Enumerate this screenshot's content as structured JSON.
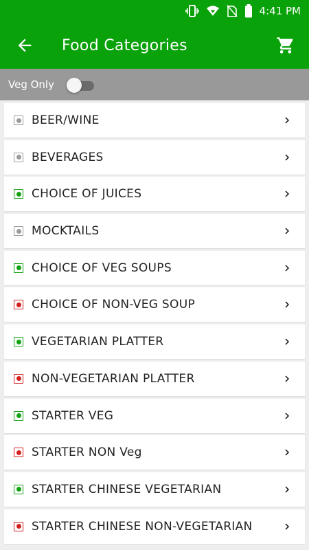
{
  "status_bar": {
    "time": "4:41 PM"
  },
  "app_bar": {
    "title": "Food Categories"
  },
  "filter": {
    "label": "Veg Only",
    "enabled": false
  },
  "colors": {
    "primary": "#0aa20a",
    "veg": "#13a313",
    "non_veg": "#d32020",
    "neutral": "#9a9a9a"
  },
  "categories": [
    {
      "label": "BEER/WINE",
      "type": "neutral"
    },
    {
      "label": "BEVERAGES",
      "type": "neutral"
    },
    {
      "label": "CHOICE OF JUICES",
      "type": "veg"
    },
    {
      "label": "MOCKTAILS",
      "type": "neutral"
    },
    {
      "label": "CHOICE OF VEG SOUPS",
      "type": "veg"
    },
    {
      "label": "CHOICE OF NON-VEG SOUP",
      "type": "non_veg"
    },
    {
      "label": "VEGETARIAN PLATTER",
      "type": "veg"
    },
    {
      "label": "NON-VEGETARIAN PLATTER",
      "type": "non_veg"
    },
    {
      "label": "STARTER VEG",
      "type": "veg"
    },
    {
      "label": "STARTER NON Veg",
      "type": "non_veg"
    },
    {
      "label": "STARTER CHINESE VEGETARIAN",
      "type": "veg"
    },
    {
      "label": "STARTER CHINESE NON-VEGETARIAN",
      "type": "non_veg"
    }
  ]
}
